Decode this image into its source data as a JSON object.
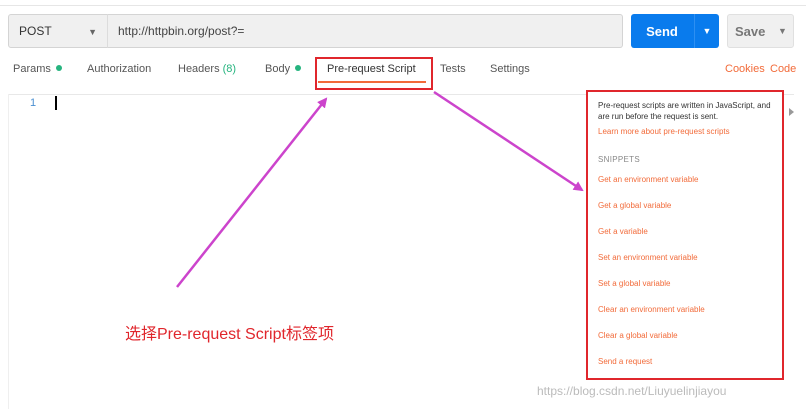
{
  "request": {
    "method": "POST",
    "url": "http://httpbin.org/post?=",
    "send_label": "Send",
    "save_label": "Save"
  },
  "tabs": [
    {
      "label": "Params",
      "dot": true
    },
    {
      "label": "Authorization"
    },
    {
      "label": "Headers",
      "count": "(8)"
    },
    {
      "label": "Body",
      "dot": true
    },
    {
      "label": "Pre-request Script",
      "active": true
    },
    {
      "label": "Tests"
    },
    {
      "label": "Settings"
    }
  ],
  "right_links": {
    "cookies": "Cookies",
    "code": "Code"
  },
  "editor": {
    "line_number": "1"
  },
  "snippets_panel": {
    "description": "Pre-request scripts are written in JavaScript, and are run before the request is sent.",
    "learn_more": "Learn more about pre-request scripts",
    "heading": "SNIPPETS",
    "items": [
      "Get an environment variable",
      "Get a global variable",
      "Get a variable",
      "Set an environment variable",
      "Set a global variable",
      "Clear an environment variable",
      "Clear a global variable",
      "Send a request"
    ]
  },
  "annotation": {
    "text": "选择Pre-request Script标签项"
  },
  "watermark": "https://blog.csdn.net/Liuyuelinjiayou",
  "colors": {
    "accent": "#f26b3a",
    "send": "#097bed",
    "annotation": "#e0262c",
    "arrow": "#cc44cc",
    "dot": "#26b47f"
  }
}
